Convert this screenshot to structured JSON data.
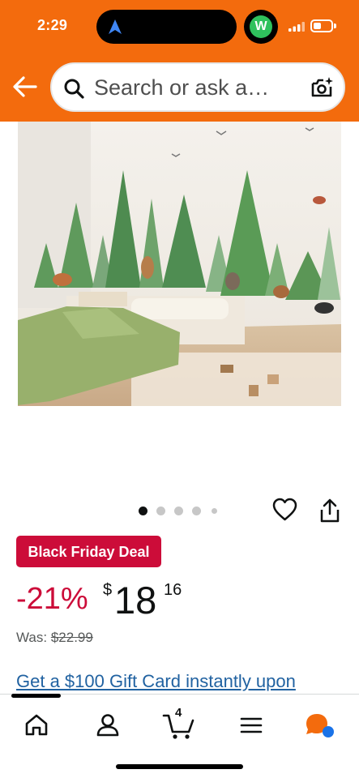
{
  "status_bar": {
    "time": "2:29"
  },
  "header": {
    "search_placeholder": "Search or ask a…"
  },
  "product": {
    "image_alt": "Forest wall decal",
    "carousel": {
      "total": 5,
      "active": 1
    },
    "deal_badge": "Black Friday Deal",
    "discount": "-21%",
    "currency": "$",
    "price_whole": "18",
    "price_fraction": "16",
    "was_label": "Was:",
    "was_price": "$22.99",
    "promo_link": "Get a $100 Gift Card instantly upon"
  },
  "bottom_nav": {
    "items": [
      "home-icon",
      "account-icon",
      "cart-icon",
      "menu-icon",
      "rufus-icon"
    ],
    "cart_count": "4"
  },
  "colors": {
    "header": "#f36b0d",
    "deal": "#cc0c39",
    "link": "#2162a1"
  }
}
